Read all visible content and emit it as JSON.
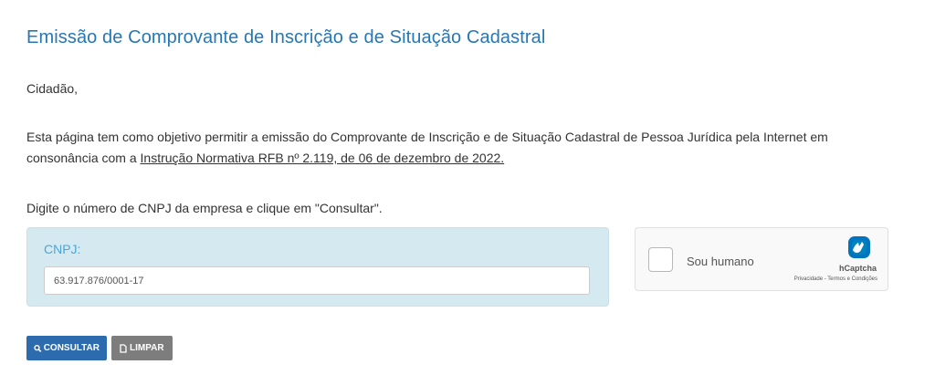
{
  "page": {
    "title": "Emissão de Comprovante de Inscrição e de Situação Cadastral",
    "greeting": "Cidadão,",
    "intro_text": "Esta página tem como objetivo permitir a emissão do Comprovante de Inscrição e de Situação Cadastral de Pessoa Jurídica pela Internet em consonância com a ",
    "intro_link": "Instrução Normativa RFB nº 2.119, de 06 de dezembro de 2022.",
    "instruction": "Digite o número de CNPJ da empresa e clique em \"Consultar\"."
  },
  "form": {
    "cnpj_label": "CNPJ:",
    "cnpj_value": "63.917.876/0001-17"
  },
  "captcha": {
    "label": "Sou humano",
    "brand": "hCaptcha",
    "privacy": "Privacidade",
    "separator": " - ",
    "terms": "Termos e Condições"
  },
  "buttons": {
    "consultar": "CONSULTAR",
    "limpar": "LIMPAR"
  },
  "icons": {
    "consultar": "search-icon",
    "limpar": "document-icon",
    "captcha": "hcaptcha-logo-icon"
  },
  "colors": {
    "title": "#2677b5",
    "panel_bg": "#d5e9f1",
    "label": "#4aa6d9",
    "primary_button": "#2c6bad",
    "secondary_button": "#7d7d7d"
  }
}
